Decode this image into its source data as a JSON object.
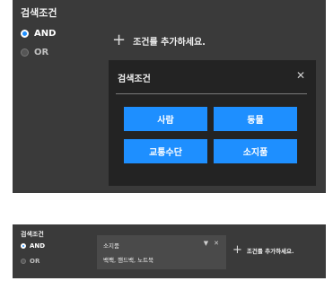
{
  "top_panel": {
    "title": "검색조건",
    "radio_and": "AND",
    "radio_or": "OR",
    "add_condition": "조건를 추가하세요.",
    "modal": {
      "title": "검색조건",
      "close_icon": "✕",
      "options": [
        "사람",
        "동물",
        "교통수단",
        "소지품"
      ]
    }
  },
  "bottom_panel": {
    "title": "검색조건",
    "radio_and": "AND",
    "radio_or": "OR",
    "filter": {
      "category": "소지품",
      "values": "백팩, 핸드백, 노트북",
      "dropdown_icon": "▼",
      "remove_icon": "✕"
    },
    "add_condition": "조건를 추가하세요."
  },
  "colors": {
    "accent": "#1e8fff",
    "panel": "#3a3a3a",
    "modal": "#232323"
  }
}
